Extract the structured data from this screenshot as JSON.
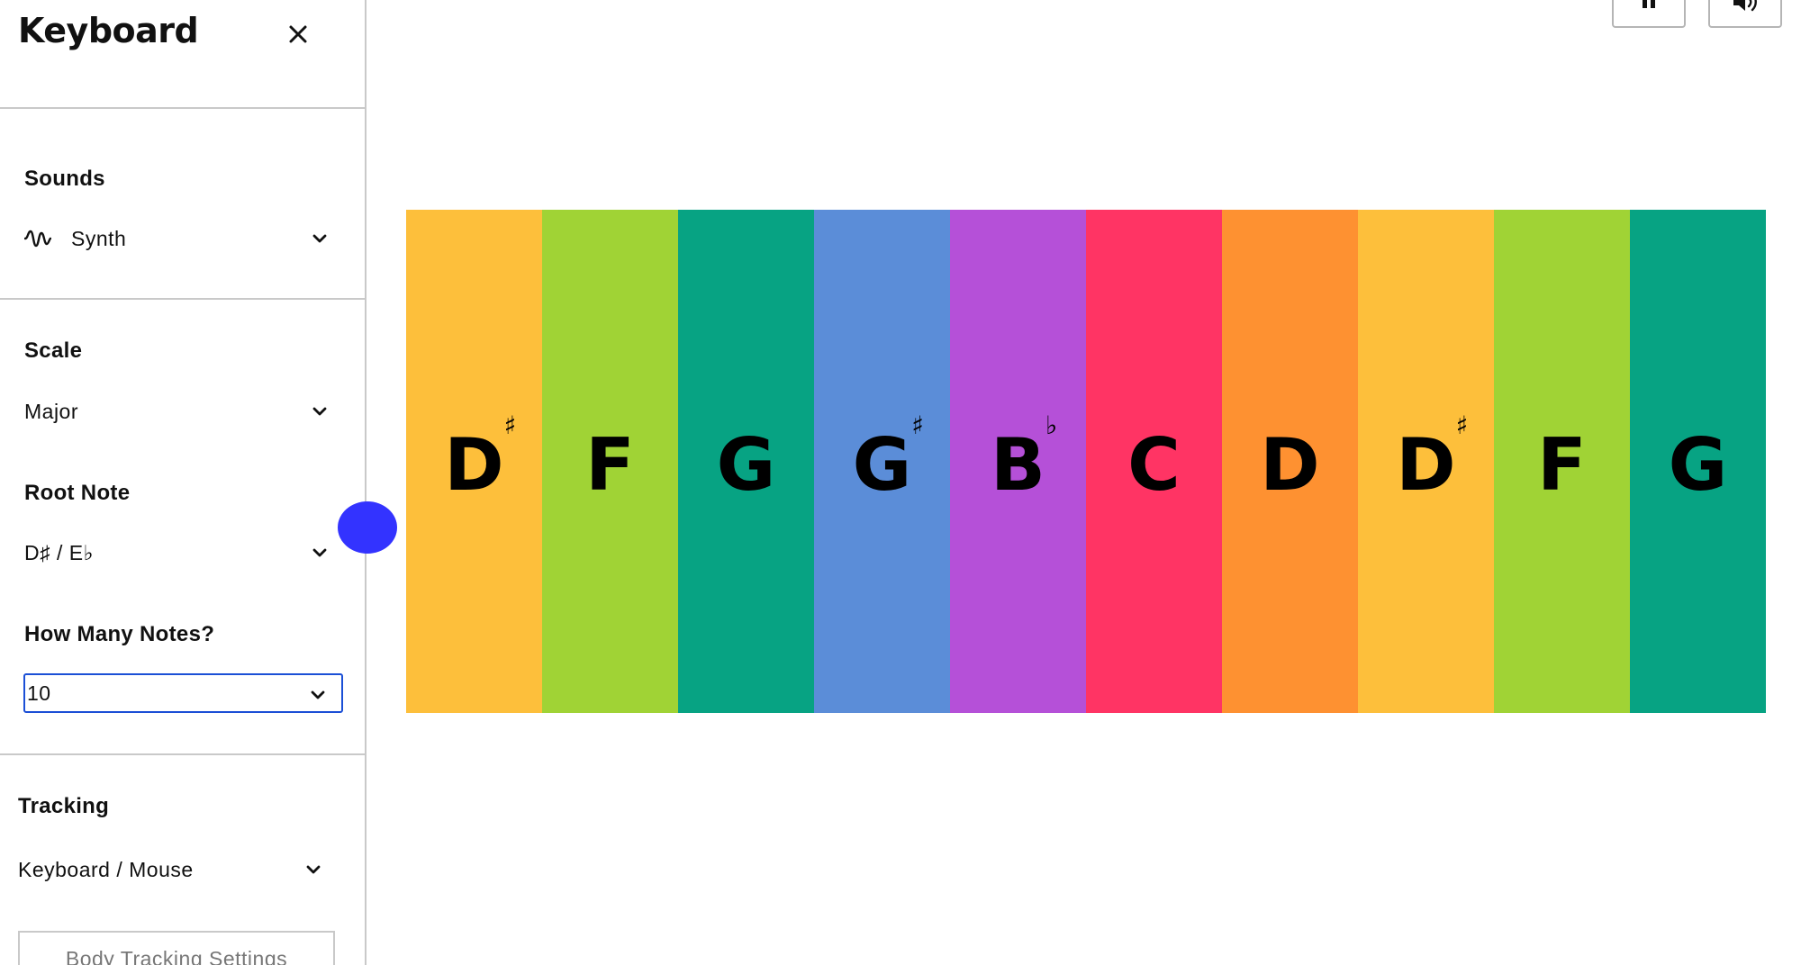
{
  "sidebar": {
    "title": "Keyboard",
    "sounds": {
      "heading": "Sounds",
      "value": "Synth",
      "icon": "waveform-icon"
    },
    "scale": {
      "heading": "Scale",
      "value": "Major"
    },
    "root_note": {
      "heading": "Root Note",
      "value": "D♯ / E♭"
    },
    "note_count": {
      "heading": "How Many Notes?",
      "value": "10"
    },
    "tracking": {
      "heading": "Tracking",
      "value": "Keyboard / Mouse"
    },
    "body_tracking_button": "Body Tracking Settings"
  },
  "controls": {
    "pause_icon": "pause-icon",
    "volume_icon": "volume-icon"
  },
  "keys": [
    {
      "note": "D",
      "accidental": "♯",
      "color": "#FDBF3B"
    },
    {
      "note": "F",
      "accidental": "",
      "color": "#A0D335"
    },
    {
      "note": "G",
      "accidental": "",
      "color": "#07A383"
    },
    {
      "note": "G",
      "accidental": "♯",
      "color": "#5B8DD8"
    },
    {
      "note": "B",
      "accidental": "♭",
      "color": "#B550D8"
    },
    {
      "note": "C",
      "accidental": "",
      "color": "#FF3464"
    },
    {
      "note": "D",
      "accidental": "",
      "color": "#FE9131"
    },
    {
      "note": "D",
      "accidental": "♯",
      "color": "#FDBF3B"
    },
    {
      "note": "F",
      "accidental": "",
      "color": "#A0D335"
    },
    {
      "note": "G",
      "accidental": "",
      "color": "#07A383"
    }
  ],
  "colors": {
    "accent_blue": "#3333FF",
    "focus_border": "#1B4FD6"
  }
}
